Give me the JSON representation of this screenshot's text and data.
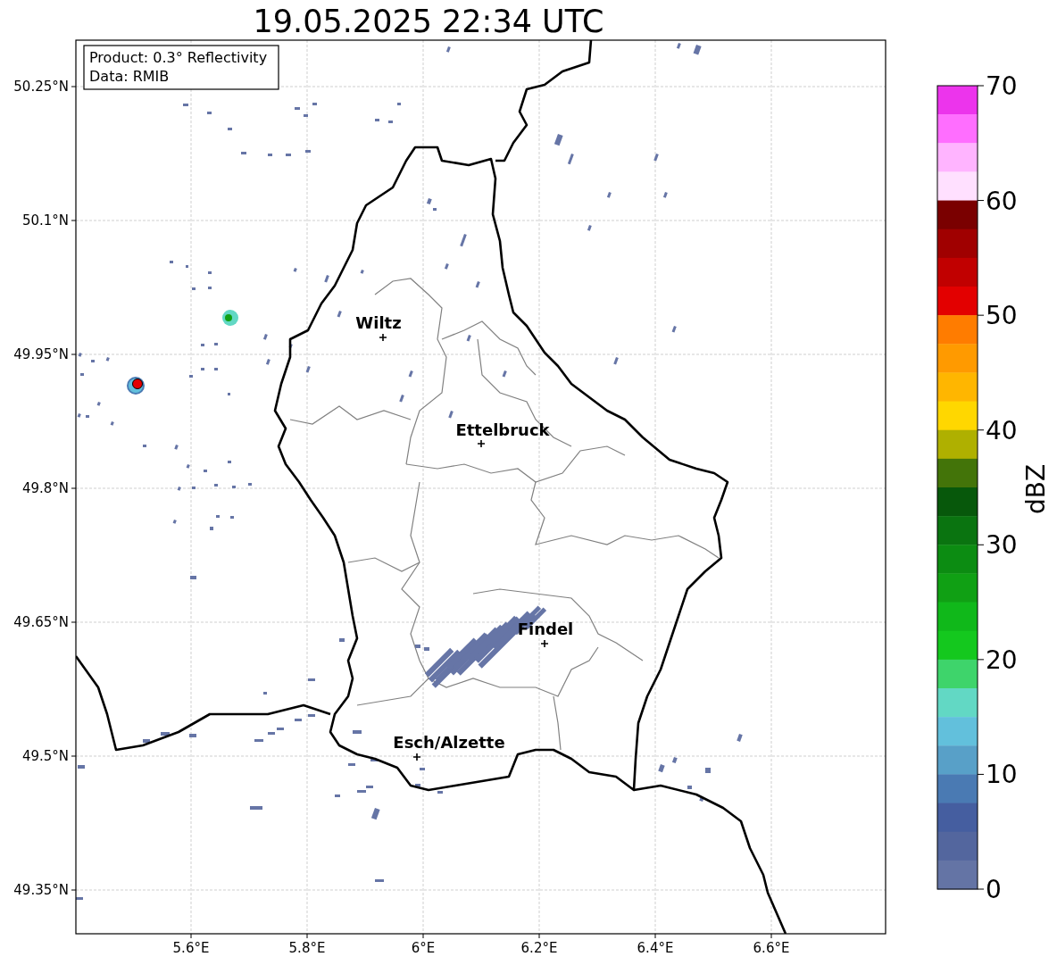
{
  "title": "19.05.2025 22:34 UTC",
  "info_box": [
    "Product: 0.3° Reflectivity",
    "Data: RMIB"
  ],
  "lat_ticks": [
    "50.25°N",
    "50.1°N",
    "49.95°N",
    "49.8°N",
    "49.65°N",
    "49.5°N",
    "49.35°N"
  ],
  "lon_ticks": [
    "5.6°E",
    "5.8°E",
    "6°E",
    "6.2°E",
    "6.4°E",
    "6.6°E"
  ],
  "places": [
    {
      "name": "Wiltz"
    },
    {
      "name": "Ettelbruck"
    },
    {
      "name": "Findel"
    },
    {
      "name": "Esch/Alzette"
    }
  ],
  "colorbar": {
    "label": "dBZ",
    "ticks": [
      "70",
      "60",
      "50",
      "40",
      "30",
      "20",
      "10",
      "0"
    ],
    "steps": [
      {
        "color": "#ec34ec"
      },
      {
        "color": "#ff6eff"
      },
      {
        "color": "#ffb4ff"
      },
      {
        "color": "#ffe0ff"
      },
      {
        "color": "#7a0000"
      },
      {
        "color": "#a00000"
      },
      {
        "color": "#c10000"
      },
      {
        "color": "#e30000"
      },
      {
        "color": "#ff7c00"
      },
      {
        "color": "#ff9a00"
      },
      {
        "color": "#ffb600"
      },
      {
        "color": "#ffd700"
      },
      {
        "color": "#afb000"
      },
      {
        "color": "#437409"
      },
      {
        "color": "#07580b"
      },
      {
        "color": "#0a7410"
      },
      {
        "color": "#0c8c12"
      },
      {
        "color": "#10a014"
      },
      {
        "color": "#10b81a"
      },
      {
        "color": "#14c81e"
      },
      {
        "color": "#3ed46b"
      },
      {
        "color": "#62d8c4"
      },
      {
        "color": "#62c0dc"
      },
      {
        "color": "#58a0c8"
      },
      {
        "color": "#4a7ab3"
      },
      {
        "color": "#455ea0"
      },
      {
        "color": "#53669e"
      },
      {
        "color": "#6474a5"
      }
    ]
  }
}
